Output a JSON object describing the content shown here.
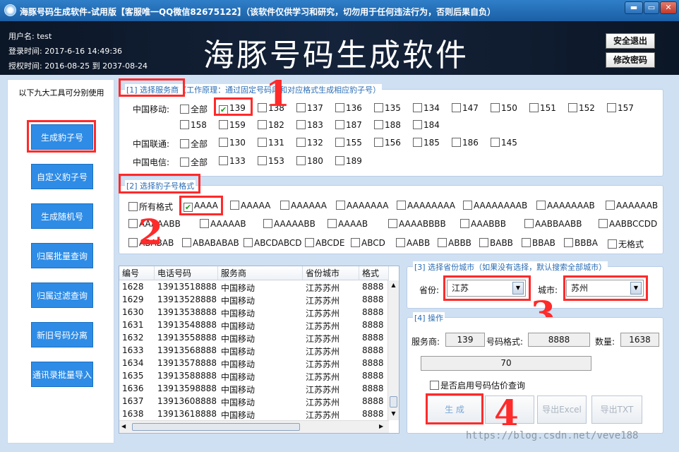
{
  "window": {
    "title": "海豚号码生成软件-试用版【客服唯一QQ微信82675122】（该软件仅供学习和研究，切勿用于任何违法行为，否则后果自负）",
    "controls": [
      "▬",
      "▭",
      "✕"
    ]
  },
  "header": {
    "username": "用户名: test",
    "login_time": "登录时间: 2017-6-16 14:49:36",
    "license_time": "授权时间: 2016-08-25 到 2037-08-24",
    "app_title": "海豚号码生成软件",
    "logout_label": "安全退出",
    "change_password_label": "修改密码"
  },
  "sidebar": {
    "tip": "以下九大工具可分别使用",
    "items": [
      "生成豹子号",
      "自定义豹子号",
      "生成随机号",
      "归属批量查询",
      "归属过滤查询",
      "新旧号码分离",
      "通讯录批量导入"
    ]
  },
  "carrier_section": {
    "title": "[1] 选择服务商（工作原理：通过固定号码段和对应格式生成相应豹子号）",
    "mobile_label": "中国移动:",
    "unicom_label": "中国联通:",
    "telecom_label": "中国电信:",
    "all_label": "全部",
    "mobile_prefixes": [
      "139",
      "138",
      "137",
      "136",
      "135",
      "134",
      "147",
      "150",
      "151",
      "152",
      "157",
      "158",
      "159",
      "182",
      "183",
      "187",
      "188",
      "184"
    ],
    "unicom_prefixes": [
      "130",
      "131",
      "132",
      "155",
      "156",
      "185",
      "186",
      "145"
    ],
    "telecom_prefixes": [
      "133",
      "153",
      "180",
      "189"
    ],
    "checked": "139"
  },
  "format_section": {
    "title": "[2] 选择豹子号格式",
    "all_label": "所有格式",
    "formats": [
      "AAAA",
      "AAAAA",
      "AAAAAA",
      "AAAAAAA",
      "AAAAAAAA",
      "AAAAAAAAB",
      "AAAAAAAB",
      "AAAAAAB",
      "AAAAABB",
      "AAAAAB",
      "AAAAABB",
      "AAAAB",
      "AAAABBBB",
      "AAABBB",
      "AABBAABB",
      "AABBCCDD",
      "ABABAB",
      "ABABABAB",
      "ABCDABCD",
      "ABCDE",
      "ABCD",
      "AABB",
      "ABBB",
      "BABB",
      "BBAB",
      "BBBA",
      "无格式"
    ],
    "checked": "AAAA"
  },
  "table": {
    "headers": [
      "编号",
      "电话号码",
      "服务商",
      "省份城市",
      "格式"
    ],
    "rows": [
      [
        "1628",
        "13913518888",
        "中国移动",
        "江苏苏州",
        "8888"
      ],
      [
        "1629",
        "13913528888",
        "中国移动",
        "江苏苏州",
        "8888"
      ],
      [
        "1630",
        "13913538888",
        "中国移动",
        "江苏苏州",
        "8888"
      ],
      [
        "1631",
        "13913548888",
        "中国移动",
        "江苏苏州",
        "8888"
      ],
      [
        "1632",
        "13913558888",
        "中国移动",
        "江苏苏州",
        "8888"
      ],
      [
        "1633",
        "13913568888",
        "中国移动",
        "江苏苏州",
        "8888"
      ],
      [
        "1634",
        "13913578888",
        "中国移动",
        "江苏苏州",
        "8888"
      ],
      [
        "1635",
        "13913588888",
        "中国移动",
        "江苏苏州",
        "8888"
      ],
      [
        "1636",
        "13913598888",
        "中国移动",
        "江苏苏州",
        "8888"
      ],
      [
        "1637",
        "13913608888",
        "中国移动",
        "江苏苏州",
        "8888"
      ],
      [
        "1638",
        "13913618888",
        "中国移动",
        "江苏苏州",
        "8888"
      ]
    ]
  },
  "region_section": {
    "title": "[3] 选择省份城市（如果没有选择，默认搜索全部城市）",
    "province_label": "省份:",
    "province_value": "江苏",
    "city_label": "城市:",
    "city_value": "苏州"
  },
  "op_section": {
    "title": "[4] 操作",
    "carrier_label": "服务商:",
    "carrier_value": "139",
    "format_label": "号码格式:",
    "format_value": "8888",
    "count_label": "数量:",
    "count_value": "1638",
    "progress_value": "70",
    "estimate_label": "是否启用号码估价查询",
    "generate_label": "生 成",
    "export_excel_label": "导出Excel",
    "export_txt_label": "导出TXT"
  },
  "annotations": [
    "1",
    "2",
    "3",
    "4"
  ],
  "watermark": "https://blog.csdn.net/veve188",
  "colors": {
    "accent": "#2e8ce6",
    "highlight": "#ff2a2a",
    "titlebar": "#1b5fa6",
    "header": "#0b1626"
  }
}
